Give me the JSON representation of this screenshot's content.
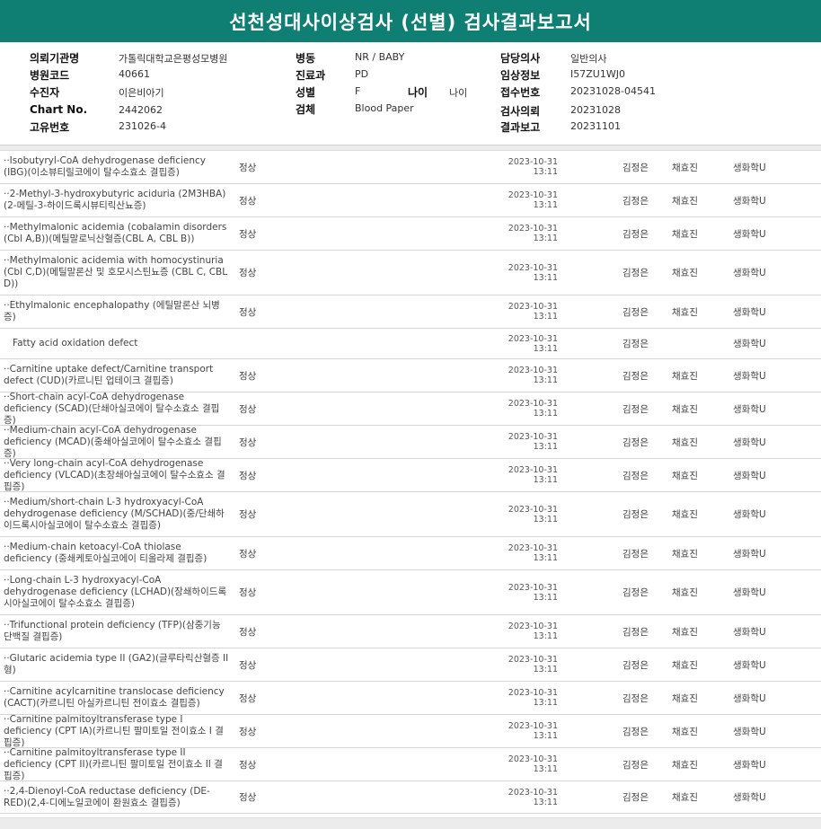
{
  "report": {
    "title": "선천성대사이상검사 (선별) 검사결과보고서"
  },
  "patient": {
    "col1": [
      {
        "label": "의뢰기관명",
        "value": "가톨릭대학교은평성모병원"
      },
      {
        "label": "병원코드",
        "value": "40661"
      },
      {
        "label": "수진자",
        "value": "이은비아기"
      },
      {
        "label": "Chart No.",
        "value": "2442062"
      },
      {
        "label": "고유번호",
        "value": "231026-4"
      }
    ],
    "col2": [
      {
        "label": "병동",
        "value": "NR / BABY"
      },
      {
        "label": "진료과",
        "value": "PD"
      },
      {
        "label": "성별",
        "value": "F"
      },
      {
        "label": "검체",
        "value": "Blood Paper"
      }
    ],
    "age": {
      "label": "나이",
      "value": "나이"
    },
    "col3": [
      {
        "label": "담당의사",
        "value": "일반의사"
      },
      {
        "label": "임상정보",
        "value": "I57ZU1WJ0"
      },
      {
        "label": "접수번호",
        "value": "20231028-04541"
      },
      {
        "label": "검사의뢰",
        "value": "20231028"
      },
      {
        "label": "결과보고",
        "value": "20231101"
      }
    ]
  },
  "rows": [
    {
      "name": "··Isobutyryl-CoA dehydrogenase deficiency (IBG)(이소뷰티릴코에이 탈수소효소 결핍증)",
      "result": "정상",
      "date": "2023-10-31",
      "time": "13:11",
      "p1": "김정은",
      "p2": "채효진",
      "dept": "생화학U",
      "h": 37
    },
    {
      "name": "··2-Methyl-3-hydroxybutyric aciduria (2M3HBA)(2-메틸-3-하이드록시뷰티릭산뇨증)",
      "result": "정상",
      "date": "2023-10-31",
      "time": "13:11",
      "p1": "김정은",
      "p2": "채효진",
      "dept": "생화학U",
      "h": 37
    },
    {
      "name": "··Methylmalonic acidemia (cobalamin disorders (Cbl A,B))(메틸말로닉산혈증(CBL A, CBL B))",
      "result": "정상",
      "date": "2023-10-31",
      "time": "13:11",
      "p1": "김정은",
      "p2": "채효진",
      "dept": "생화학U",
      "h": 37
    },
    {
      "name": "··Methylmalonic acidemia with homocystinuria (Cbl C,D)(메틸말론산 및 호모시스틴뇨증 (CBL C, CBL D))",
      "result": "정상",
      "date": "2023-10-31",
      "time": "13:11",
      "p1": "김정은",
      "p2": "채효진",
      "dept": "생화학U",
      "h": 50
    },
    {
      "name": "··Ethylmalonic encephalopathy (에틸말론산 뇌병증)",
      "result": "정상",
      "date": "2023-10-31",
      "time": "13:11",
      "p1": "김정은",
      "p2": "채효진",
      "dept": "생화학U",
      "h": 37
    },
    {
      "name": "Fatty acid oxidation defect",
      "result": "",
      "date": "2023-10-31",
      "time": "13:11",
      "p1": "김정은",
      "p2": "",
      "dept": "생화학U",
      "h": 34,
      "group": true
    },
    {
      "name": "··Carnitine uptake defect/Carnitine transport defect (CUD)(카르니틴 업테이크 결핍증)",
      "result": "정상",
      "date": "2023-10-31",
      "time": "13:11",
      "p1": "김정은",
      "p2": "채효진",
      "dept": "생화학U",
      "h": 37
    },
    {
      "name": "··Short-chain acyl-CoA dehydrogenase deficiency (SCAD)(단쇄아실코에이 탈수소효소 결핍증)",
      "result": "정상",
      "date": "2023-10-31",
      "time": "13:11",
      "p1": "김정은",
      "p2": "채효진",
      "dept": "생화학U",
      "h": 37
    },
    {
      "name": "··Medium-chain acyl-CoA dehydrogenase deficiency (MCAD)(중쇄아실코에이 탈수소효소 결핍증)",
      "result": "정상",
      "date": "2023-10-31",
      "time": "13:11",
      "p1": "김정은",
      "p2": "채효진",
      "dept": "생화학U",
      "h": 37
    },
    {
      "name": "··Very long-chain acyl-CoA dehydrogenase deficiency (VLCAD)(초장쇄아실코에이 탈수소효소 결핍증)",
      "result": "정상",
      "date": "2023-10-31",
      "time": "13:11",
      "p1": "김정은",
      "p2": "채효진",
      "dept": "생화학U",
      "h": 37
    },
    {
      "name": "··Medium/short-chain L-3 hydroxyacyl-CoA dehydrogenase deficiency (M/SCHAD)(중/단쇄하이드록시아실코에이 탈수소효소 결핍증)",
      "result": "정상",
      "date": "2023-10-31",
      "time": "13:11",
      "p1": "김정은",
      "p2": "채효진",
      "dept": "생화학U",
      "h": 50
    },
    {
      "name": "··Medium-chain ketoacyl-CoA thiolase deficiency (중쇄케토아실코에이 티올라제 결핍증)",
      "result": "정상",
      "date": "2023-10-31",
      "time": "13:11",
      "p1": "김정은",
      "p2": "채효진",
      "dept": "생화학U",
      "h": 37
    },
    {
      "name": "··Long-chain L-3 hydroxyacyl-CoA dehydrogenase deficiency (LCHAD)(장쇄하이드록시아실코에이 탈수소효소 결핍증)",
      "result": "정상",
      "date": "2023-10-31",
      "time": "13:11",
      "p1": "김정은",
      "p2": "채효진",
      "dept": "생화학U",
      "h": 50
    },
    {
      "name": "··Trifunctional protein deficiency (TFP)(삼중기능 단백질 결핍증)",
      "result": "정상",
      "date": "2023-10-31",
      "time": "13:11",
      "p1": "김정은",
      "p2": "채효진",
      "dept": "생화학U",
      "h": 37
    },
    {
      "name": "··Glutaric acidemia type II (GA2)(글루타릭산혈증 II형)",
      "result": "정상",
      "date": "2023-10-31",
      "time": "13:11",
      "p1": "김정은",
      "p2": "채효진",
      "dept": "생화학U",
      "h": 37
    },
    {
      "name": "··Carnitine acylcarnitine translocase deficiency (CACT)(카르니틴 아실카르니틴 전이효소 결핍증)",
      "result": "정상",
      "date": "2023-10-31",
      "time": "13:11",
      "p1": "김정은",
      "p2": "채효진",
      "dept": "생화학U",
      "h": 37
    },
    {
      "name": "··Carnitine palmitoyltransferase type I deficiency (CPT IA)(카르니틴 팔미토일 전이효소 I 결핍증)",
      "result": "정상",
      "date": "2023-10-31",
      "time": "13:11",
      "p1": "김정은",
      "p2": "채효진",
      "dept": "생화학U",
      "h": 37
    },
    {
      "name": "··Carnitine palmitoyltransferase type II deficiency (CPT II)(카르니틴 팔미토일 전이효소 II 결핍증)",
      "result": "정상",
      "date": "2023-10-31",
      "time": "13:11",
      "p1": "김정은",
      "p2": "채효진",
      "dept": "생화학U",
      "h": 37
    },
    {
      "name": "··2,4-Dienoyl-CoA reductase deficiency (DE-RED)(2,4-디에노일코에이 환원효소 결핍증)",
      "result": "정상",
      "date": "2023-10-31",
      "time": "13:11",
      "p1": "김정은",
      "p2": "채효진",
      "dept": "생화학U",
      "h": 36
    }
  ],
  "colors": {
    "title_bg": "#0f7f74",
    "title_fg": "#ffffff"
  }
}
